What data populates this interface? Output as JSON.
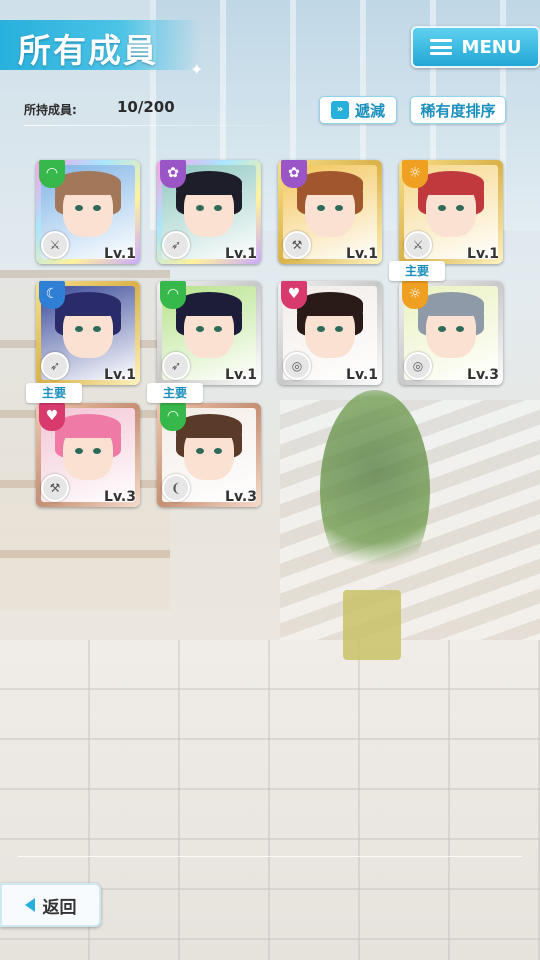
{
  "header": {
    "title": "所有成員",
    "menu_label": "MENU"
  },
  "held": {
    "label": "所持成員:",
    "value": "10/200"
  },
  "toolbar": {
    "filter_label": "遞減",
    "sort_label": "稀有度排序"
  },
  "members": [
    {
      "level": "Lv.1",
      "attr_icon": "wind-icon",
      "attr_color": "#37b84a",
      "weapon": "sword-icon",
      "frame": "rainbow",
      "hair": "#a2775a",
      "bg": "#7fb4e6",
      "main": ""
    },
    {
      "level": "Lv.1",
      "attr_icon": "flower-icon",
      "attr_color": "#9a55c7",
      "weapon": "gun-icon",
      "frame": "rainbow",
      "hair": "#1e1e2a",
      "bg": "#8fc8c0",
      "main": ""
    },
    {
      "level": "Lv.1",
      "attr_icon": "flower-icon",
      "attr_color": "#9a55c7",
      "weapon": "axe-icon",
      "frame": "gold",
      "hair": "#a0572e",
      "bg": "#f3c65a",
      "main": ""
    },
    {
      "level": "Lv.1",
      "attr_icon": "sun-icon",
      "attr_color": "#f0a021",
      "weapon": "sword-icon",
      "frame": "gold",
      "hair": "#c0393d",
      "bg": "#f6d88a",
      "main": ""
    },
    {
      "level": "Lv.1",
      "attr_icon": "moon-icon",
      "attr_color": "#2f7fd6",
      "weapon": "gun-icon",
      "frame": "gold",
      "hair": "#2a2c6a",
      "bg": "#3a4a9a",
      "main": ""
    },
    {
      "level": "Lv.1",
      "attr_icon": "wind-icon",
      "attr_color": "#37b84a",
      "weapon": "gun-icon",
      "frame": "silver",
      "hair": "#1d1d3a",
      "bg": "#b6e38a",
      "main": ""
    },
    {
      "level": "Lv.1",
      "attr_icon": "heart-icon",
      "attr_color": "#d93a6e",
      "weapon": "shield-icon",
      "frame": "silver",
      "hair": "#2a1a18",
      "bg": "#f2ece8",
      "main": ""
    },
    {
      "level": "Lv.3",
      "attr_icon": "sun-icon",
      "attr_color": "#f0a021",
      "weapon": "shield-icon",
      "frame": "silver",
      "hair": "#8e9aa8",
      "bg": "#eaf2c0",
      "main": "主要"
    },
    {
      "level": "Lv.3",
      "attr_icon": "heart-icon",
      "attr_color": "#d93a6e",
      "weapon": "axe-icon",
      "frame": "bronze",
      "hair": "#f07aa6",
      "bg": "#f2c4d4",
      "main": "主要"
    },
    {
      "level": "Lv.3",
      "attr_icon": "wind-icon",
      "attr_color": "#37b84a",
      "weapon": "bow-icon",
      "frame": "bronze",
      "hair": "#5a3a28",
      "bg": "#f3ece6",
      "main": "主要"
    }
  ],
  "footer": {
    "back_label": "返回"
  }
}
